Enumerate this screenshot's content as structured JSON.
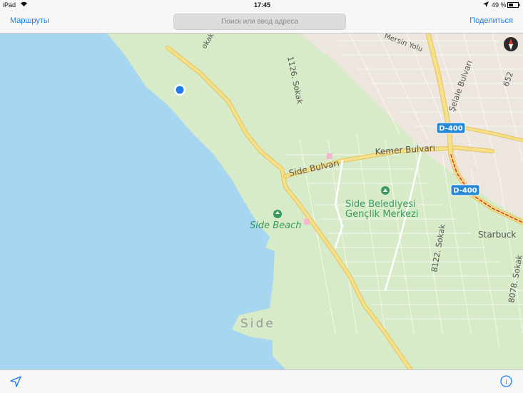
{
  "status": {
    "device": "iPad",
    "time": "17:45",
    "battery": "49 %",
    "icons": [
      "wifi-icon",
      "location-arrow-icon",
      "battery-icon"
    ]
  },
  "nav": {
    "left_label": "Маршруты",
    "search_placeholder": "Поиск или ввод адреса",
    "right_label": "Поделиться"
  },
  "map": {
    "streets": {
      "kemer": "Kemer Bulvarı",
      "side_bulvari": "Side Bulvarı",
      "sokak_1126": "1126. Sokak",
      "sokak_8122": "8122. Sokak",
      "sokak_8078": "8078. Sokak",
      "mersin": "Mersin Yolu",
      "selale": "Şelale Bulvarı",
      "sokak_652": "652",
      "sokak_top": "okak"
    },
    "highway_shields": [
      "D-400",
      "D-400"
    ],
    "pois": {
      "beach": "Side Beach",
      "center_line1": "Side Belediyesi",
      "center_line2": "Gençlik Merkezi",
      "starbucks": "Starbuck"
    },
    "area_label": "Side",
    "colors": {
      "water": "#a6d6f0",
      "land": "#d8ebc8",
      "urban": "#ece6de",
      "road": "#f5d77a",
      "poi_green": "#3a9a5e",
      "accent": "#1a7cf5"
    }
  },
  "bottom": {
    "icons": [
      "location-arrow-icon",
      "info-icon"
    ]
  }
}
